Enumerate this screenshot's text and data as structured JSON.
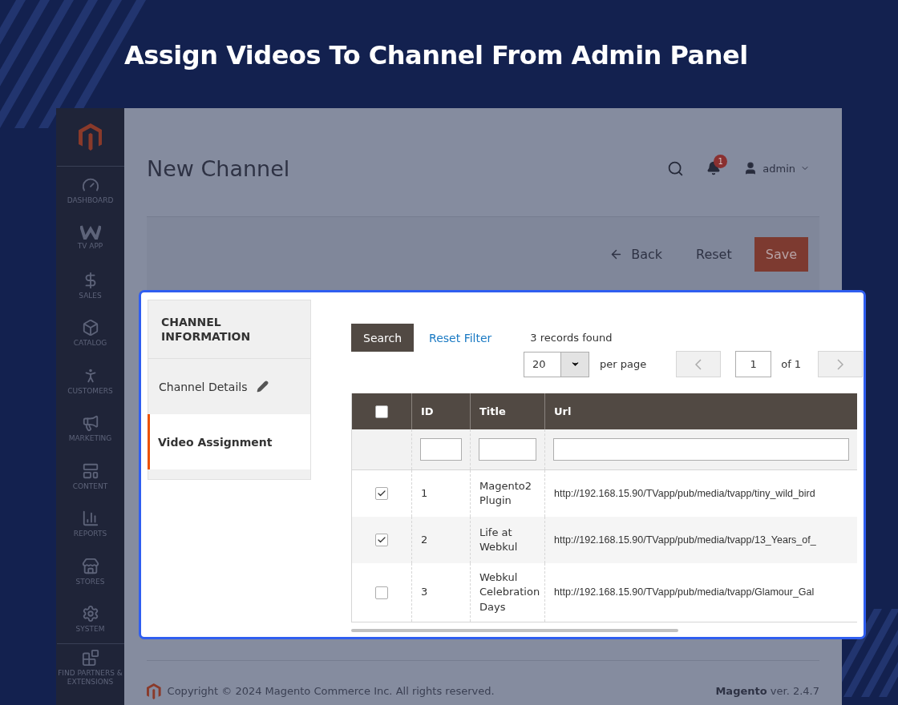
{
  "headline": "Assign Videos To Channel From Admin Panel",
  "admin": {
    "sidebar": {
      "items": [
        {
          "label": "DASHBOARD"
        },
        {
          "label": "TV APP"
        },
        {
          "label": "SALES"
        },
        {
          "label": "CATALOG"
        },
        {
          "label": "CUSTOMERS"
        },
        {
          "label": "MARKETING"
        },
        {
          "label": "CONTENT"
        },
        {
          "label": "REPORTS"
        },
        {
          "label": "STORES"
        },
        {
          "label": "SYSTEM"
        },
        {
          "label": "FIND PARTNERS & EXTENSIONS"
        }
      ]
    },
    "page_title": "New Channel",
    "notifications": "1",
    "user": "admin",
    "actions": [
      {
        "label": "Back",
        "kind": "back"
      },
      {
        "label": "Reset",
        "kind": "plain"
      },
      {
        "label": "Save",
        "kind": "primary"
      }
    ],
    "footer": {
      "copyright": "Copyright © 2024 Magento Commerce Inc. All rights reserved.",
      "version": "**Magento** ver. 2.4.7"
    }
  },
  "panel": {
    "section_title": "CHANNEL INFORMATION",
    "tabs": [
      {
        "label": "Channel Details",
        "selected": false
      },
      {
        "label": "Video Assignment",
        "selected": true
      }
    ],
    "toolbar": {
      "search_button": "Search",
      "reset_filter": "Reset Filter",
      "records": "3 records found",
      "page_size": "20",
      "per_page": "per page",
      "page": "1",
      "page_total": "of 1"
    },
    "table": {
      "select_all_checked": false,
      "columns": [
        "ID",
        "Title",
        "Url"
      ],
      "rows": [
        {
          "checked": true,
          "id": "1",
          "title": "Magento2 Plugin",
          "url": "http://192.168.15.90/TVapp/pub/media/tvapp/tiny_wild_bird"
        },
        {
          "checked": true,
          "id": "2",
          "title": "Life at Webkul",
          "url": "http://192.168.15.90/TVapp/pub/media/tvapp/13_Years_of_"
        },
        {
          "checked": false,
          "id": "3",
          "title": "Webkul Celebration Days",
          "url": "http://192.168.15.90/TVapp/pub/media/tvapp/Glamour_Gal"
        }
      ]
    }
  }
}
